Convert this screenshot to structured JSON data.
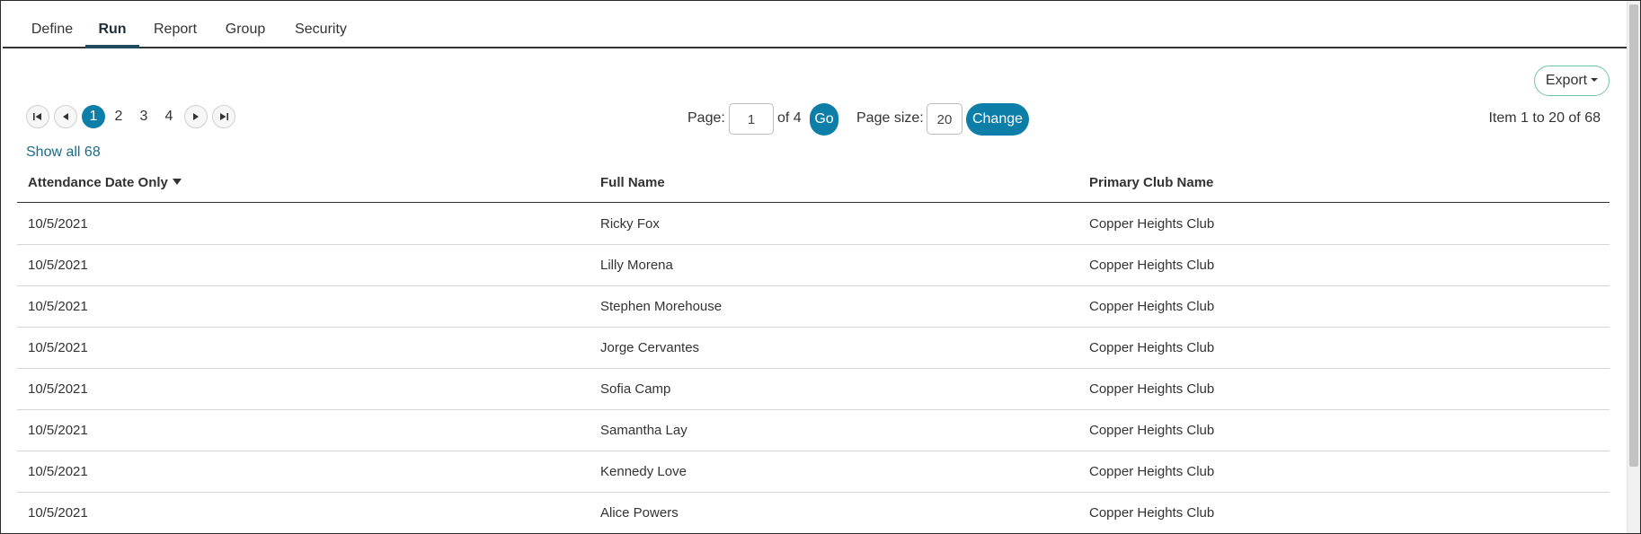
{
  "tabs": [
    {
      "label": "Define",
      "active": false
    },
    {
      "label": "Run",
      "active": true
    },
    {
      "label": "Report",
      "active": false
    },
    {
      "label": "Group",
      "active": false
    },
    {
      "label": "Security",
      "active": false
    }
  ],
  "export": {
    "label": "Export"
  },
  "pager": {
    "pages": [
      "1",
      "2",
      "3",
      "4"
    ],
    "current_page": "1",
    "page_label": "Page:",
    "page_input_value": "1",
    "of_total": "of 4",
    "go_label": "Go",
    "page_size_label": "Page size:",
    "page_size_value": "20",
    "change_label": "Change",
    "item_range": "Item 1 to 20 of 68",
    "show_all": "Show all 68"
  },
  "table": {
    "columns": [
      "Attendance Date Only",
      "Full Name",
      "Primary Club Name"
    ],
    "sorted_column": "Attendance Date Only",
    "sort_direction": "descending",
    "rows": [
      [
        "10/5/2021",
        "Ricky Fox",
        "Copper Heights Club"
      ],
      [
        "10/5/2021",
        "Lilly Morena",
        "Copper Heights Club"
      ],
      [
        "10/5/2021",
        "Stephen Morehouse",
        "Copper Heights Club"
      ],
      [
        "10/5/2021",
        "Jorge Cervantes",
        "Copper Heights Club"
      ],
      [
        "10/5/2021",
        "Sofia Camp",
        "Copper Heights Club"
      ],
      [
        "10/5/2021",
        "Samantha Lay",
        "Copper Heights Club"
      ],
      [
        "10/5/2021",
        "Kennedy Love",
        "Copper Heights Club"
      ],
      [
        "10/5/2021",
        "Alice Powers",
        "Copper Heights Club"
      ]
    ]
  },
  "colors": {
    "accent": "#0d7ea8",
    "export_border": "#6fc3a8",
    "link": "#1a6b86"
  }
}
